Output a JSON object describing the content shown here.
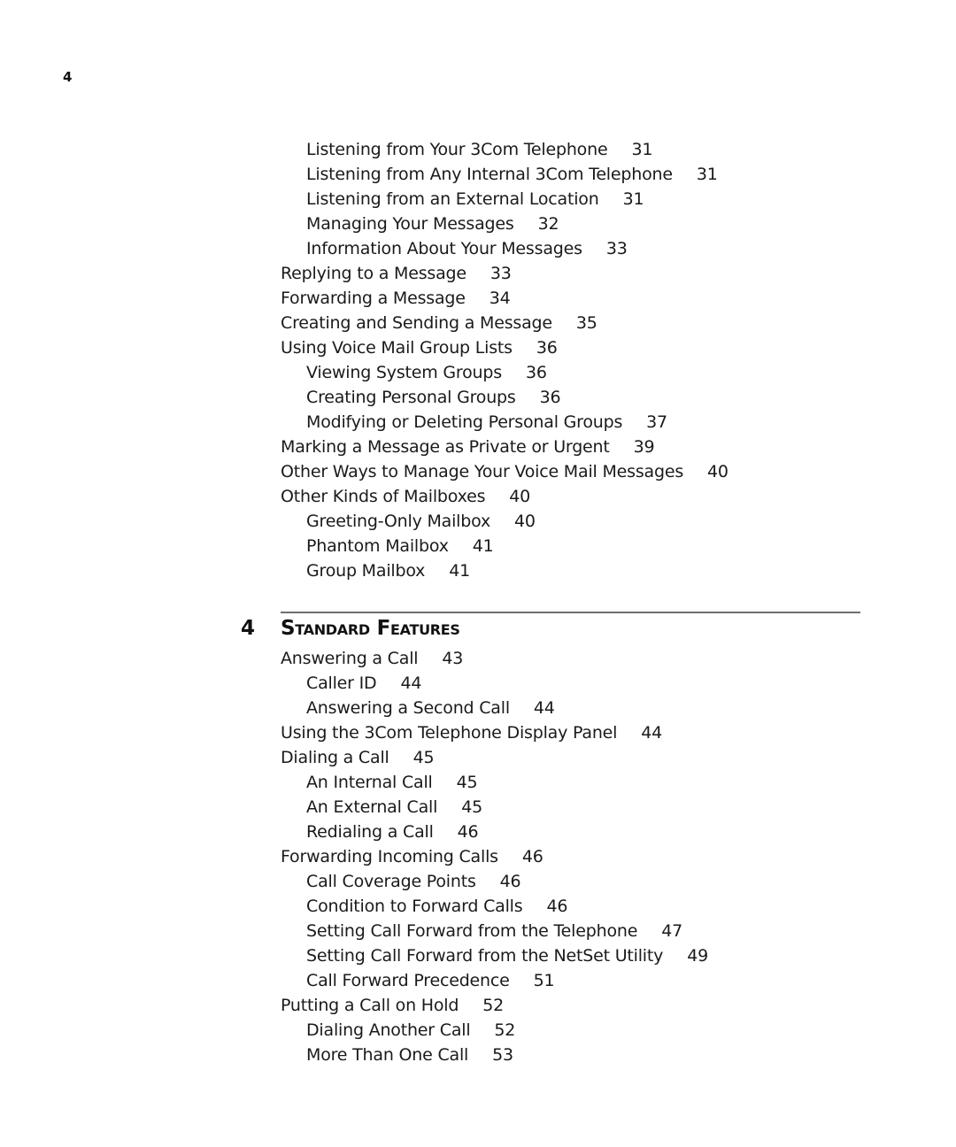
{
  "page_number": "4",
  "section_continued": [
    {
      "title": "Listening from Your 3Com Telephone",
      "page": "31",
      "level": 2
    },
    {
      "title": "Listening from Any Internal 3Com Telephone",
      "page": "31",
      "level": 2
    },
    {
      "title": "Listening from an External Location",
      "page": "31",
      "level": 2
    },
    {
      "title": "Managing Your Messages",
      "page": "32",
      "level": 2
    },
    {
      "title": "Information About Your Messages",
      "page": "33",
      "level": 2
    },
    {
      "title": "Replying to a Message",
      "page": "33",
      "level": 1
    },
    {
      "title": "Forwarding a Message",
      "page": "34",
      "level": 1
    },
    {
      "title": "Creating and Sending a Message",
      "page": "35",
      "level": 1
    },
    {
      "title": "Using Voice Mail Group Lists",
      "page": "36",
      "level": 1
    },
    {
      "title": "Viewing System Groups",
      "page": "36",
      "level": 2
    },
    {
      "title": "Creating Personal Groups",
      "page": "36",
      "level": 2
    },
    {
      "title": "Modifying or Deleting Personal Groups",
      "page": "37",
      "level": 2
    },
    {
      "title": "Marking a Message as Private or Urgent",
      "page": "39",
      "level": 1
    },
    {
      "title": "Other Ways to Manage Your Voice Mail Messages",
      "page": "40",
      "level": 1
    },
    {
      "title": "Other Kinds of Mailboxes",
      "page": "40",
      "level": 1
    },
    {
      "title": "Greeting-Only Mailbox",
      "page": "40",
      "level": 2
    },
    {
      "title": "Phantom Mailbox",
      "page": "41",
      "level": 2
    },
    {
      "title": "Group Mailbox",
      "page": "41",
      "level": 2
    }
  ],
  "chapter": {
    "number": "4",
    "title": "Standard Features",
    "entries": [
      {
        "title": "Answering a Call",
        "page": "43",
        "level": 1
      },
      {
        "title": "Caller ID",
        "page": "44",
        "level": 2
      },
      {
        "title": "Answering a Second Call",
        "page": "44",
        "level": 2
      },
      {
        "title": "Using the 3Com Telephone Display Panel",
        "page": "44",
        "level": 1
      },
      {
        "title": "Dialing a Call",
        "page": "45",
        "level": 1
      },
      {
        "title": "An Internal Call",
        "page": "45",
        "level": 2
      },
      {
        "title": "An External Call",
        "page": "45",
        "level": 2
      },
      {
        "title": "Redialing a Call",
        "page": "46",
        "level": 2
      },
      {
        "title": "Forwarding Incoming Calls",
        "page": "46",
        "level": 1
      },
      {
        "title": "Call Coverage Points",
        "page": "46",
        "level": 2
      },
      {
        "title": "Condition to Forward Calls",
        "page": "46",
        "level": 2
      },
      {
        "title": "Setting Call Forward from the Telephone",
        "page": "47",
        "level": 2
      },
      {
        "title": "Setting Call Forward from the NetSet Utility",
        "page": "49",
        "level": 2
      },
      {
        "title": "Call Forward Precedence",
        "page": "51",
        "level": 2
      },
      {
        "title": "Putting a Call on Hold",
        "page": "52",
        "level": 1
      },
      {
        "title": "Dialing Another Call",
        "page": "52",
        "level": 2
      },
      {
        "title": "More Than One Call",
        "page": "53",
        "level": 2
      }
    ]
  }
}
